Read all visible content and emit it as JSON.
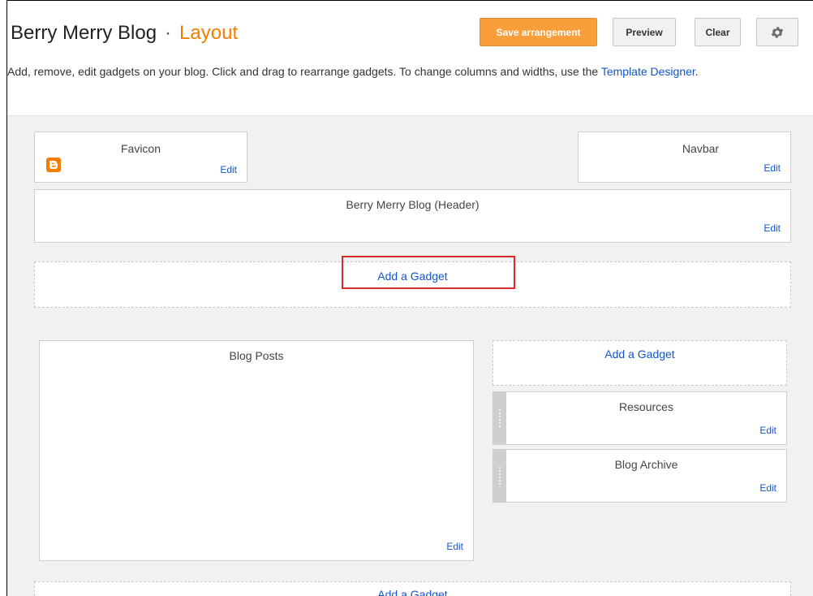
{
  "header": {
    "blog_name": "Berry Merry Blog",
    "separator": "·",
    "page": "Layout",
    "save_label": "Save arrangement",
    "preview_label": "Preview",
    "clear_label": "Clear",
    "settings_icon": "gear-icon"
  },
  "description": {
    "text": "Add, remove, edit gadgets on your blog. Click and drag to rearrange gadgets. To change columns and widths, use the ",
    "link": "Template Designer",
    "end": "."
  },
  "layout": {
    "favicon": {
      "title": "Favicon",
      "icon": "blogger-icon",
      "edit": "Edit"
    },
    "navbar": {
      "title": "Navbar",
      "edit": "Edit"
    },
    "header_gadget": {
      "title": "Berry Merry Blog (Header)",
      "edit": "Edit"
    },
    "add_gadget_top": "Add a Gadget",
    "blog_posts": {
      "title": "Blog Posts",
      "edit": "Edit"
    },
    "add_gadget_sidebar": "Add a Gadget",
    "resources": {
      "title": "Resources",
      "edit": "Edit"
    },
    "blog_archive": {
      "title": "Blog Archive",
      "edit": "Edit"
    },
    "add_gadget_bottom": "Add a Gadget"
  },
  "colors": {
    "accent": "#f57d00",
    "save_button": "#f89e3b",
    "link": "#1155cc",
    "highlight": "#d92b2b"
  }
}
